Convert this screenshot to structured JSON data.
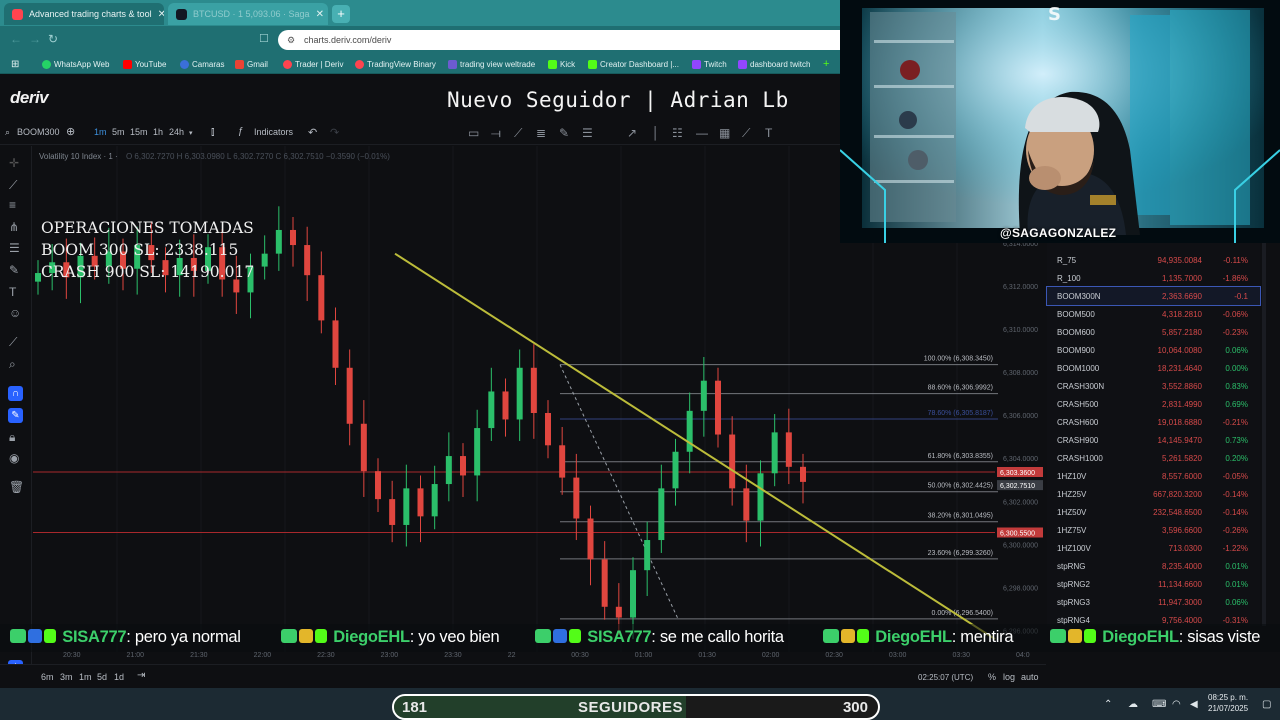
{
  "browser": {
    "tabs": [
      {
        "label": "Advanced trading charts & tool",
        "active": true,
        "icon": "deriv-icon"
      },
      {
        "label": "BTCUSD · 1 5,093.06 · Saga",
        "active": false,
        "icon": "tradingview-icon"
      }
    ],
    "url": "charts.deriv.com/deriv",
    "bookmarks": [
      {
        "label": "WhatsApp Web",
        "color": "#25d366"
      },
      {
        "label": "YouTube",
        "color": "#ff0000"
      },
      {
        "label": "Camaras",
        "color": "#3b6fd8"
      },
      {
        "label": "Gmail",
        "color": "#ea4335"
      },
      {
        "label": "Trader | Deriv",
        "color": "#ff444f"
      },
      {
        "label": "TradingView Binary",
        "color": "#ff444f"
      },
      {
        "label": "trading view weltrade",
        "color": "#6d5bd0"
      },
      {
        "label": "Kick",
        "color": "#53fc18"
      },
      {
        "label": "Creator Dashboard |...",
        "color": "#53fc18"
      },
      {
        "label": "Twitch",
        "color": "#9146ff"
      },
      {
        "label": "dashboard twitch",
        "color": "#9146ff"
      }
    ]
  },
  "header": {
    "logo": "deriv",
    "overlay_title": "Nuevo Seguidor | Adrian Lb"
  },
  "toolbar": {
    "symbol": "BOOM300",
    "timeframes": [
      "1m",
      "5m",
      "15m",
      "1h",
      "24h"
    ],
    "selected_timeframe": "1m",
    "indicators_label": "Indicators"
  },
  "legend": {
    "title": "Volatility 10 Index · 1 ·",
    "ohlc": "O 6,302.7270 H 6,303.0980 L 6,302.7270 C 6,302.7510 −0.3590 (−0.01%)"
  },
  "operations": {
    "line1": "OPERACIONES TOMADAS",
    "line2": "BOOM 300 SL: 2338.115",
    "line3": "CRASH 900 SL: 14190.017"
  },
  "chart_data": {
    "type": "candlestick",
    "price_axis": [
      "6,316.0000",
      "6,314.0000",
      "6,312.0000",
      "6,310.0000",
      "6,308.0000",
      "6,306.0000",
      "6,304.0000",
      "6,302.0000",
      "6,300.0000",
      "6,298.0000",
      "6,296.0000"
    ],
    "y_range": [
      6295.0,
      6318.5
    ],
    "time_axis": [
      "20:30",
      "21:00",
      "21:30",
      "22:00",
      "22:30",
      "23:00",
      "23:30",
      "22",
      "00:30",
      "01:00",
      "01:30",
      "02:00",
      "02:30",
      "03:00",
      "03:30",
      "04:0"
    ],
    "price_tags": [
      {
        "label": "6,303.3600",
        "price": 6303.36,
        "color": "#c23b3b"
      },
      {
        "label": "6,302.7510",
        "price": 6302.751,
        "color": "#3a3d44"
      },
      {
        "label": "6,300.5500",
        "price": 6300.55,
        "color": "#c23b3b"
      }
    ],
    "horizontal_lines": [
      6303.36,
      6300.55
    ],
    "fibonacci": [
      {
        "label": "100.00% (6,308.3450)",
        "price": 6308.345
      },
      {
        "label": "88.60% (6,306.9992)",
        "price": 6306.9992
      },
      {
        "label": "78.60% (6,305.8187)",
        "price": 6305.8187
      },
      {
        "label": "61.80% (6,303.8355)",
        "price": 6303.8355
      },
      {
        "label": "50.00% (6,302.4425)",
        "price": 6302.4425
      },
      {
        "label": "38.20% (6,301.0495)",
        "price": 6301.0495
      },
      {
        "label": "23.60% (6,299.3260)",
        "price": 6299.326
      },
      {
        "label": "0.00% (6,296.5400)",
        "price": 6296.54
      }
    ],
    "trendline": {
      "from_price": 6313.5,
      "to_price": 6295.6
    },
    "series_close": [
      6312.6,
      6313.1,
      6312.4,
      6313.4,
      6312.9,
      6313.6,
      6312.8,
      6313.9,
      6313.2,
      6312.5,
      6313.3,
      6312.7,
      6313.8,
      6312.3,
      6311.7,
      6312.9,
      6313.5,
      6314.6,
      6313.9,
      6312.5,
      6310.4,
      6308.2,
      6305.6,
      6303.4,
      6302.1,
      6300.9,
      6302.6,
      6301.3,
      6302.8,
      6304.1,
      6303.2,
      6305.4,
      6307.1,
      6305.8,
      6308.2,
      6306.1,
      6304.6,
      6303.1,
      6301.2,
      6299.3,
      6297.1,
      6296.6,
      6298.8,
      6300.2,
      6302.6,
      6304.3,
      6306.2,
      6307.6,
      6305.1,
      6302.6,
      6301.1,
      6303.3,
      6305.2,
      6303.6,
      6302.9
    ]
  },
  "symbols": [
    {
      "name": "R_75",
      "price": "94,935.0084",
      "change": "-0.11%"
    },
    {
      "name": "R_100",
      "price": "1,135.7000",
      "change": "-1.86%"
    },
    {
      "name": "BOOM300N",
      "price": "2,363.6690",
      "change": "-0.1",
      "selected": true
    },
    {
      "name": "BOOM500",
      "price": "4,318.2810",
      "change": "-0.06%"
    },
    {
      "name": "BOOM600",
      "price": "5,857.2180",
      "change": "-0.23%"
    },
    {
      "name": "BOOM900",
      "price": "10,064.0080",
      "change": "0.06%"
    },
    {
      "name": "BOOM1000",
      "price": "18,231.4640",
      "change": "0.00%"
    },
    {
      "name": "CRASH300N",
      "price": "3,552.8860",
      "change": "0.83%"
    },
    {
      "name": "CRASH500",
      "price": "2,831.4990",
      "change": "0.69%"
    },
    {
      "name": "CRASH600",
      "price": "19,018.6880",
      "change": "-0.21%"
    },
    {
      "name": "CRASH900",
      "price": "14,145.9470",
      "change": "0.73%"
    },
    {
      "name": "CRASH1000",
      "price": "5,261.5820",
      "change": "0.20%"
    },
    {
      "name": "1HZ10V",
      "price": "8,557.6000",
      "change": "-0.05%"
    },
    {
      "name": "1HZ25V",
      "price": "667,820.3200",
      "change": "-0.14%"
    },
    {
      "name": "1HZ50V",
      "price": "232,548.6500",
      "change": "-0.14%"
    },
    {
      "name": "1HZ75V",
      "price": "3,596.6600",
      "change": "-0.26%"
    },
    {
      "name": "1HZ100V",
      "price": "713.0300",
      "change": "-1.22%"
    },
    {
      "name": "stpRNG",
      "price": "8,235.4000",
      "change": "0.01%"
    },
    {
      "name": "stpRNG2",
      "price": "11,134.6600",
      "change": "0.01%"
    },
    {
      "name": "stpRNG3",
      "price": "11,947.3000",
      "change": "0.06%"
    },
    {
      "name": "stpRNG4",
      "price": "9,756.4000",
      "change": "-0.31%"
    }
  ],
  "colors": {
    "positive": "#2bbf6a",
    "negative": "#d64a4a",
    "accent": "#2962ff"
  },
  "webcam": {
    "handle": "@SAGAGONZALEZ"
  },
  "chat": [
    {
      "user": "SISA777",
      "text": ": pero ya normal"
    },
    {
      "user": "DiegoEHL",
      "text": ": yo veo bien"
    },
    {
      "user": "SISA777",
      "text": ": se me callo horita"
    },
    {
      "user": "DiegoEHL",
      "text": ": mentira"
    },
    {
      "user": "DiegoEHL",
      "text": ": sisas viste"
    }
  ],
  "bottom": {
    "ranges": [
      "6m",
      "3m",
      "1m",
      "5d",
      "1d"
    ],
    "clock": "02:25:07 (UTC)",
    "percent": "%",
    "log": "log",
    "auto": "auto"
  },
  "followers": {
    "current": "181",
    "label": "SEGUIDORES",
    "goal": "300",
    "progress": 0.6033
  },
  "taskbar": {
    "time": "08:25 p. m.",
    "date": "21/07/2025"
  }
}
